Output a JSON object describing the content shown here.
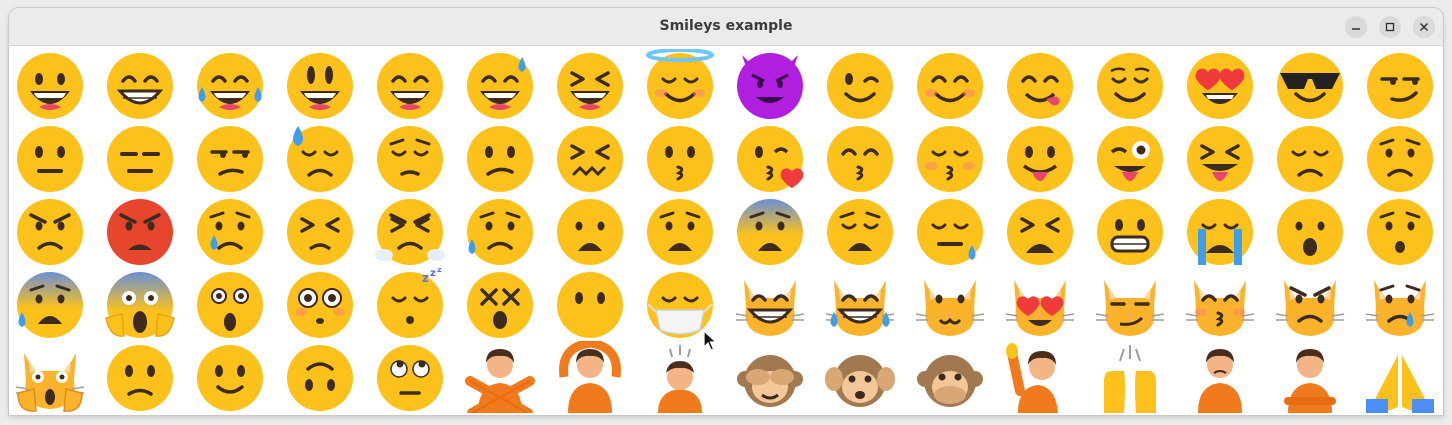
{
  "window": {
    "title": "Smileys example"
  },
  "controls": {
    "minimize": "minimize-icon",
    "maximize": "maximize-icon",
    "close": "close-icon"
  },
  "emoji_grid": {
    "rows": [
      [
        "grinning-face",
        "grinning-face-with-smiling-eyes",
        "face-with-tears-of-joy",
        "smiling-face-with-open-mouth",
        "smiling-face-with-open-mouth-and-smiling-eyes",
        "grinning-face-with-sweat",
        "grinning-squinting-face",
        "smiling-face-with-halo",
        "smiling-face-with-horns",
        "winking-face",
        "smiling-face-with-smiling-eyes",
        "face-savoring-food",
        "relieved-face",
        "smiling-face-with-heart-eyes",
        "smiling-face-with-sunglasses",
        "smirking-face"
      ],
      [
        "neutral-face",
        "expressionless-face",
        "unamused-face",
        "downcast-face-with-sweat",
        "pensive-face",
        "confused-face",
        "confounded-face",
        "kissing-face",
        "face-blowing-a-kiss",
        "kissing-face-with-smiling-eyes",
        "kissing-face-with-closed-eyes",
        "face-with-tongue",
        "winking-face-with-tongue",
        "squinting-face-with-tongue",
        "disappointed-face",
        "worried-face"
      ],
      [
        "angry-face",
        "pouting-face",
        "crying-face",
        "persevering-face",
        "face-with-steam-from-nose",
        "sad-but-relieved-face",
        "frowning-face-with-open-mouth",
        "anguished-face",
        "fearful-face",
        "weary-face",
        "sleepy-face",
        "tired-face",
        "grimacing-face",
        "loudly-crying-face",
        "face-with-open-mouth",
        "hushed-face"
      ],
      [
        "anxious-face-with-sweat",
        "face-screaming-in-fear",
        "astonished-face",
        "flushed-face",
        "sleeping-face",
        "dizzy-face",
        "face-without-mouth",
        "face-with-medical-mask",
        "grinning-cat-with-smiling-eyes",
        "cat-with-tears-of-joy",
        "smiling-cat",
        "smiling-cat-with-heart-eyes",
        "cat-with-wry-smile",
        "kissing-cat",
        "pouting-cat",
        "crying-cat"
      ],
      [
        "weary-cat",
        "slightly-frowning-face",
        "slightly-smiling-face",
        "upside-down-face",
        "face-with-rolling-eyes",
        "person-gesturing-no",
        "person-gesturing-ok",
        "person-bowing",
        "see-no-evil-monkey",
        "hear-no-evil-monkey",
        "speak-no-evil-monkey",
        "person-raising-hand",
        "raising-hands",
        "person-frowning",
        "person-pouting",
        "folded-hands"
      ]
    ]
  },
  "colors": {
    "face": "#fcc21b",
    "face_edge": "#eaa31c",
    "feature": "#3d2b1f",
    "tongue": "#e8456b",
    "tear": "#3e9ee8",
    "cat": "#fbb32c",
    "person_shirt": "#f17a1c",
    "monkey": "#a1784f",
    "accent_purple": "#b01ee0",
    "pouting_red": "#e6462c"
  }
}
